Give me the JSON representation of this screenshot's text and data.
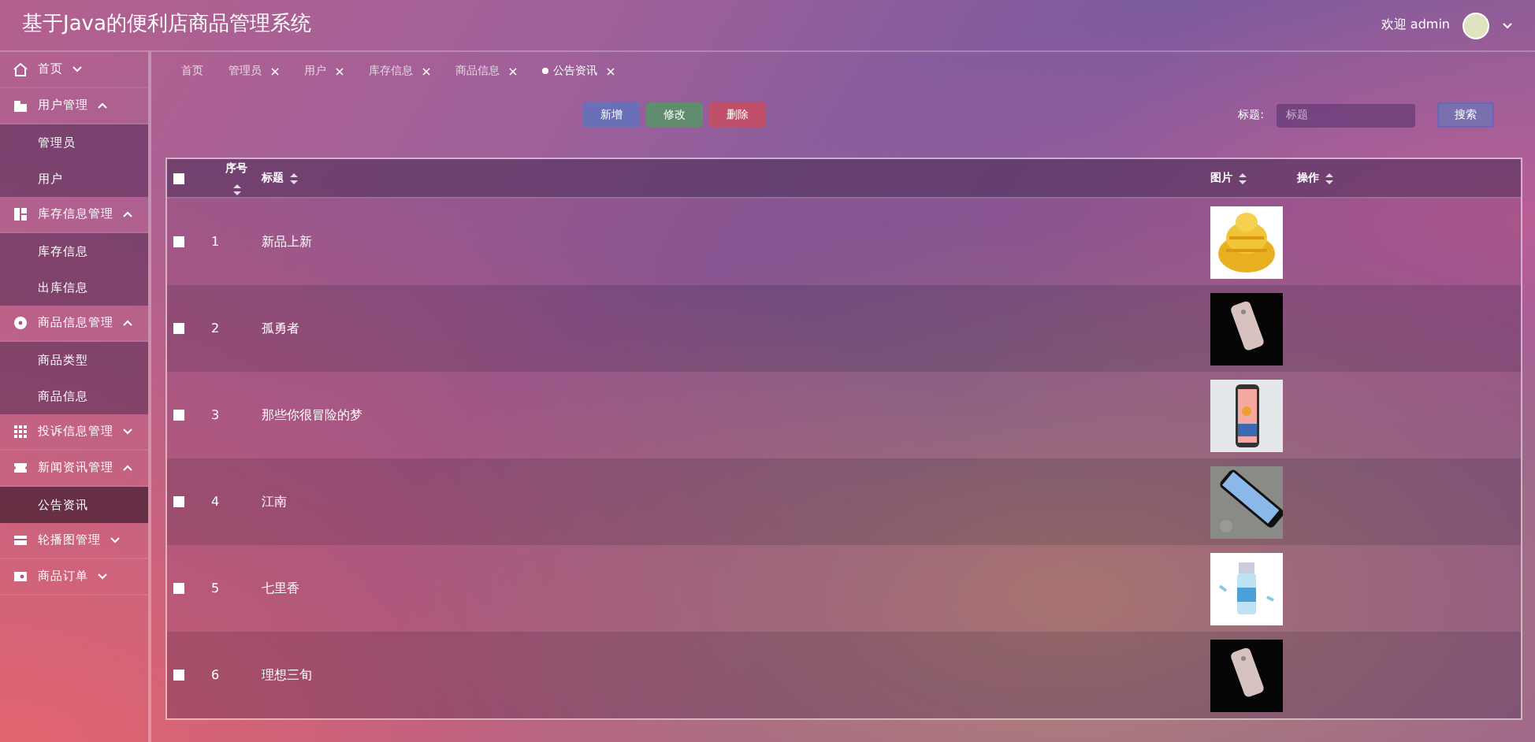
{
  "header": {
    "title": "基于Java的便利店商品管理系统",
    "welcome": "欢迎 admin"
  },
  "sidebar": {
    "items": [
      {
        "label": "首页",
        "expanded": false
      },
      {
        "label": "用户管理",
        "expanded": true,
        "children": [
          {
            "label": "管理员",
            "selected": false
          },
          {
            "label": "用户",
            "selected": false
          }
        ]
      },
      {
        "label": "库存信息管理",
        "expanded": true,
        "children": [
          {
            "label": "库存信息",
            "selected": false
          },
          {
            "label": "出库信息",
            "selected": false
          }
        ]
      },
      {
        "label": "商品信息管理",
        "expanded": true,
        "children": [
          {
            "label": "商品类型",
            "selected": false
          },
          {
            "label": "商品信息",
            "selected": false
          }
        ]
      },
      {
        "label": "投诉信息管理",
        "expanded": false
      },
      {
        "label": "新闻资讯管理",
        "expanded": true,
        "children": [
          {
            "label": "公告资讯",
            "selected": true
          }
        ]
      },
      {
        "label": "轮播图管理",
        "expanded": false
      },
      {
        "label": "商品订单",
        "expanded": false
      }
    ]
  },
  "tabs": [
    {
      "label": "首页",
      "closable": false,
      "selected": false
    },
    {
      "label": "管理员",
      "closable": true,
      "selected": false
    },
    {
      "label": "用户",
      "closable": true,
      "selected": false
    },
    {
      "label": "库存信息",
      "closable": true,
      "selected": false
    },
    {
      "label": "商品信息",
      "closable": true,
      "selected": false
    },
    {
      "label": "公告资讯",
      "closable": true,
      "selected": true
    }
  ],
  "toolbar": {
    "buttons": [
      {
        "label": "新增",
        "kind": "add"
      },
      {
        "label": "修改",
        "kind": "edit"
      },
      {
        "label": "删除",
        "kind": "delete"
      }
    ],
    "search": {
      "label": "标题:",
      "placeholder": "标题",
      "button": "搜索"
    }
  },
  "table": {
    "select_all": {
      "checked": false
    },
    "columns": [
      {
        "label": "序号",
        "sortable": true
      },
      {
        "label": "标题",
        "sortable": true
      },
      {
        "label": "图片",
        "sortable": true
      },
      {
        "label": "操作",
        "sortable": true
      }
    ],
    "rows": [
      {
        "checked": false,
        "index": "1",
        "title": "新品上新"
      },
      {
        "checked": false,
        "index": "2",
        "title": "孤勇者"
      },
      {
        "checked": false,
        "index": "3",
        "title": "那些你很冒险的梦"
      },
      {
        "checked": false,
        "index": "4",
        "title": "江南"
      },
      {
        "checked": false,
        "index": "5",
        "title": "七里香"
      },
      {
        "checked": false,
        "index": "6",
        "title": "理想三旬"
      }
    ]
  }
}
